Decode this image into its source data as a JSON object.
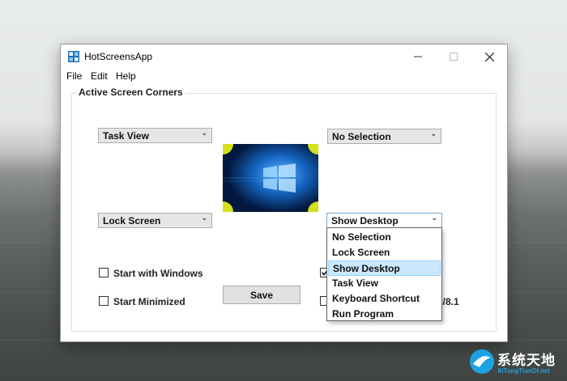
{
  "window": {
    "title": "HotScreensApp"
  },
  "menu": {
    "items": [
      "File",
      "Edit",
      "Help"
    ]
  },
  "group": {
    "label": "Active Screen Corners"
  },
  "corners": {
    "top_left": "Task View",
    "top_right": "No Selection",
    "bottom_left": "Lock Screen",
    "bottom_right": "Show Desktop"
  },
  "dropdown": {
    "options": [
      "No Selection",
      "Lock Screen",
      "Show Desktop",
      "Task View",
      "Keyboard Shortcut",
      "Run Program"
    ],
    "selected": "Show Desktop"
  },
  "options": {
    "start_with_windows": {
      "label": "Start with Windows",
      "checked": false
    },
    "start_minimized": {
      "label": "Start Minimized",
      "checked": false
    }
  },
  "partial": {
    "text_right": "8/8.1"
  },
  "save_label": "Save",
  "watermark": {
    "title": "系统天地",
    "sub": "XiTongTianDi.net"
  },
  "colors": {
    "corner_marker": "#d5e21a",
    "selected_item": "#cce8ff",
    "wallpaper": "#0a4fa8"
  }
}
